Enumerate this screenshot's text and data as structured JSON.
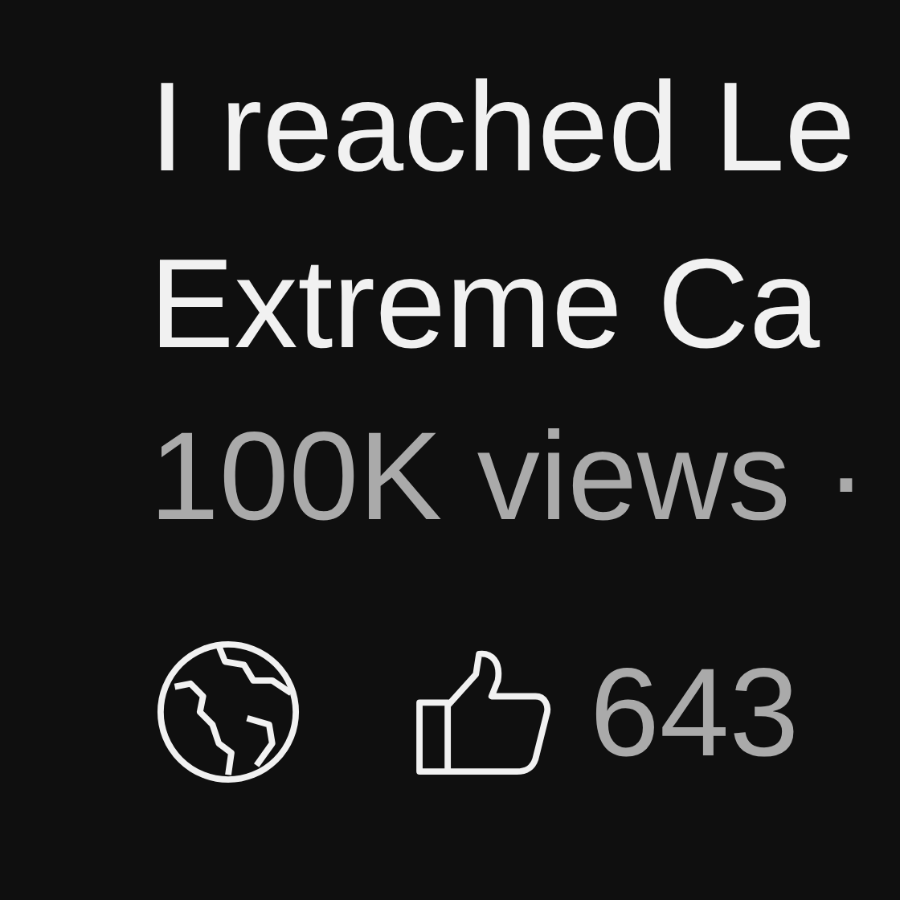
{
  "video": {
    "title_lines": [
      "I reached Le",
      "Extreme Ca"
    ],
    "views": "100K views ·",
    "likes": "643"
  }
}
